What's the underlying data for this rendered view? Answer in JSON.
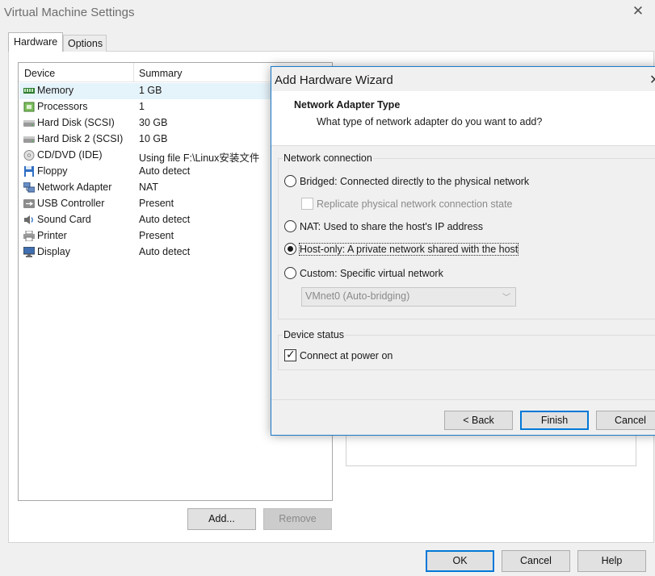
{
  "window": {
    "title": "Virtual Machine Settings"
  },
  "tabs": [
    "Hardware",
    "Options"
  ],
  "device_list": {
    "headers": {
      "device": "Device",
      "summary": "Summary"
    },
    "rows": [
      {
        "name": "Memory",
        "summary": "1 GB",
        "icon": "memory-icon"
      },
      {
        "name": "Processors",
        "summary": "1",
        "icon": "processor-icon"
      },
      {
        "name": "Hard Disk (SCSI)",
        "summary": "30 GB",
        "icon": "hard-disk-icon"
      },
      {
        "name": "Hard Disk 2 (SCSI)",
        "summary": "10 GB",
        "icon": "hard-disk-icon"
      },
      {
        "name": "CD/DVD (IDE)",
        "summary": "Using file F:\\Linux安装文件",
        "icon": "cd-dvd-icon"
      },
      {
        "name": "Floppy",
        "summary": "Auto detect",
        "icon": "floppy-icon"
      },
      {
        "name": "Network Adapter",
        "summary": "NAT",
        "icon": "network-adapter-icon"
      },
      {
        "name": "USB Controller",
        "summary": "Present",
        "icon": "usb-icon"
      },
      {
        "name": "Sound Card",
        "summary": "Auto detect",
        "icon": "sound-card-icon"
      },
      {
        "name": "Printer",
        "summary": "Present",
        "icon": "printer-icon"
      },
      {
        "name": "Display",
        "summary": "Auto detect",
        "icon": "display-icon"
      }
    ],
    "selected_index": 0
  },
  "list_buttons": {
    "add": "Add...",
    "remove": "Remove"
  },
  "footer_buttons": {
    "ok": "OK",
    "cancel": "Cancel",
    "help": "Help"
  },
  "wizard": {
    "title": "Add Hardware Wizard",
    "heading": "Network Adapter Type",
    "subheading": "What type of network adapter do you want to add?",
    "network_group_label": "Network connection",
    "options": {
      "bridged": "Bridged: Connected directly to the physical network",
      "replicate": "Replicate physical network connection state",
      "nat": "NAT: Used to share the host's IP address",
      "hostonly": "Host-only: A private network shared with the host",
      "custom": "Custom: Specific virtual network"
    },
    "selected_option": "hostonly",
    "vmnet_select": "VMnet0 (Auto-bridging)",
    "device_status_label": "Device status",
    "connect_at_power_on": "Connect at power on",
    "connect_checked": true,
    "buttons": {
      "back": "< Back",
      "finish": "Finish",
      "cancel": "Cancel"
    }
  },
  "colors": {
    "selection": "#e5f3fb",
    "accent": "#0078d7"
  }
}
